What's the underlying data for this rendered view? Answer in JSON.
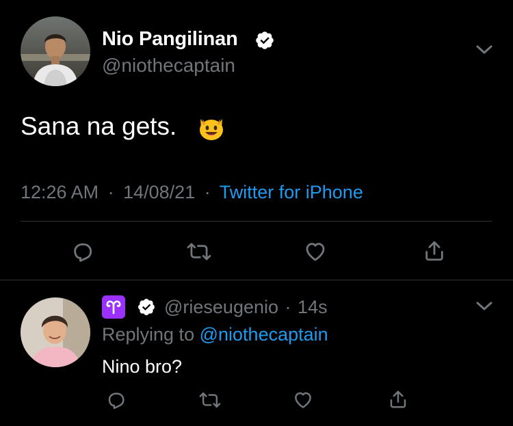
{
  "main_tweet": {
    "display_name": "Nio Pangilinan",
    "handle": "@niothecaptain",
    "text": "Sana na gets.",
    "emoji": "😺",
    "time": "12:26 AM",
    "date": "14/08/21",
    "separator": "·",
    "source": "Twitter for iPhone"
  },
  "reply": {
    "zodiac": "♈",
    "handle": "@rieseugenio",
    "separator": "·",
    "age": "14s",
    "replying_prefix": "Replying to",
    "replying_to": "@niothecaptain",
    "text": "Nino bro?"
  },
  "icons": {
    "more": "chevron-down-icon",
    "verified": "verified-badge-icon",
    "reply": "reply-icon",
    "retweet": "retweet-icon",
    "like": "heart-icon",
    "share": "share-icon"
  },
  "colors": {
    "background": "#000000",
    "link": "#1d9bf0",
    "muted": "#71767b",
    "divider": "#2f3336",
    "zodiac_bg": "#9b30ff"
  }
}
